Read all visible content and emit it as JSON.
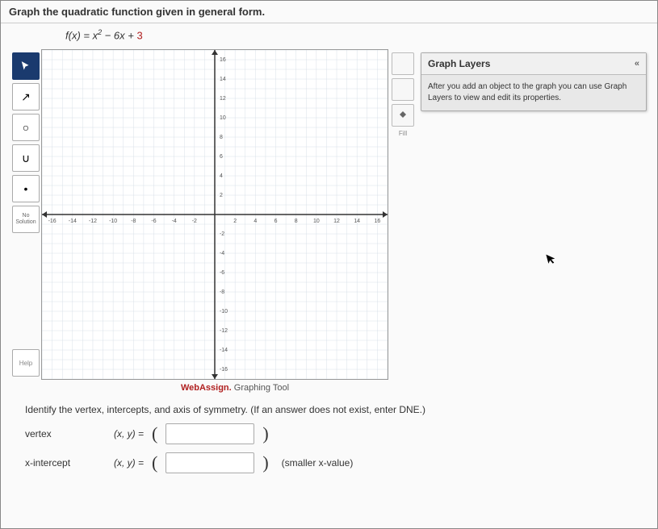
{
  "header": {
    "title": "Graph the quadratic function given in general form.",
    "equation_prefix": "f(x) = x",
    "equation_exp": "2",
    "equation_mid": " − 6x + ",
    "equation_const": "3"
  },
  "toolbar": {
    "pointer": "➤",
    "line": "↗",
    "circle": "○",
    "parabola": "∪",
    "point": "•",
    "nosol": "No\nSolution",
    "help": "Help"
  },
  "side": {
    "clearall": " ",
    "delete": " ",
    "fill": "Fill"
  },
  "layers": {
    "title": "Graph Layers",
    "collapse": "«",
    "body": "After you add an object to the graph you can use Graph Layers to view and edit its properties."
  },
  "footer": {
    "brand_strong": "WebAssign.",
    "brand_rest": " Graphing Tool"
  },
  "questions": {
    "instruct": "Identify the vertex, intercepts, and axis of symmetry. (If an answer does not exist, enter DNE.)",
    "vertex_label": "vertex",
    "xint_label": "x-intercept",
    "eq": "(x, y)  =  ",
    "xint_after": "(smaller x-value)"
  },
  "chart_data": {
    "type": "scatter",
    "title": "",
    "xlabel": "",
    "ylabel": "",
    "xlim": [
      -17,
      17
    ],
    "ylim": [
      -17,
      17
    ],
    "x_ticks": [
      -16,
      -14,
      -12,
      -10,
      -8,
      -6,
      -4,
      -2,
      2,
      4,
      6,
      8,
      10,
      12,
      14,
      16
    ],
    "y_ticks": [
      -16,
      -14,
      -12,
      -10,
      -8,
      -6,
      -4,
      -2,
      2,
      4,
      6,
      8,
      10,
      12,
      14,
      16
    ],
    "series": []
  }
}
